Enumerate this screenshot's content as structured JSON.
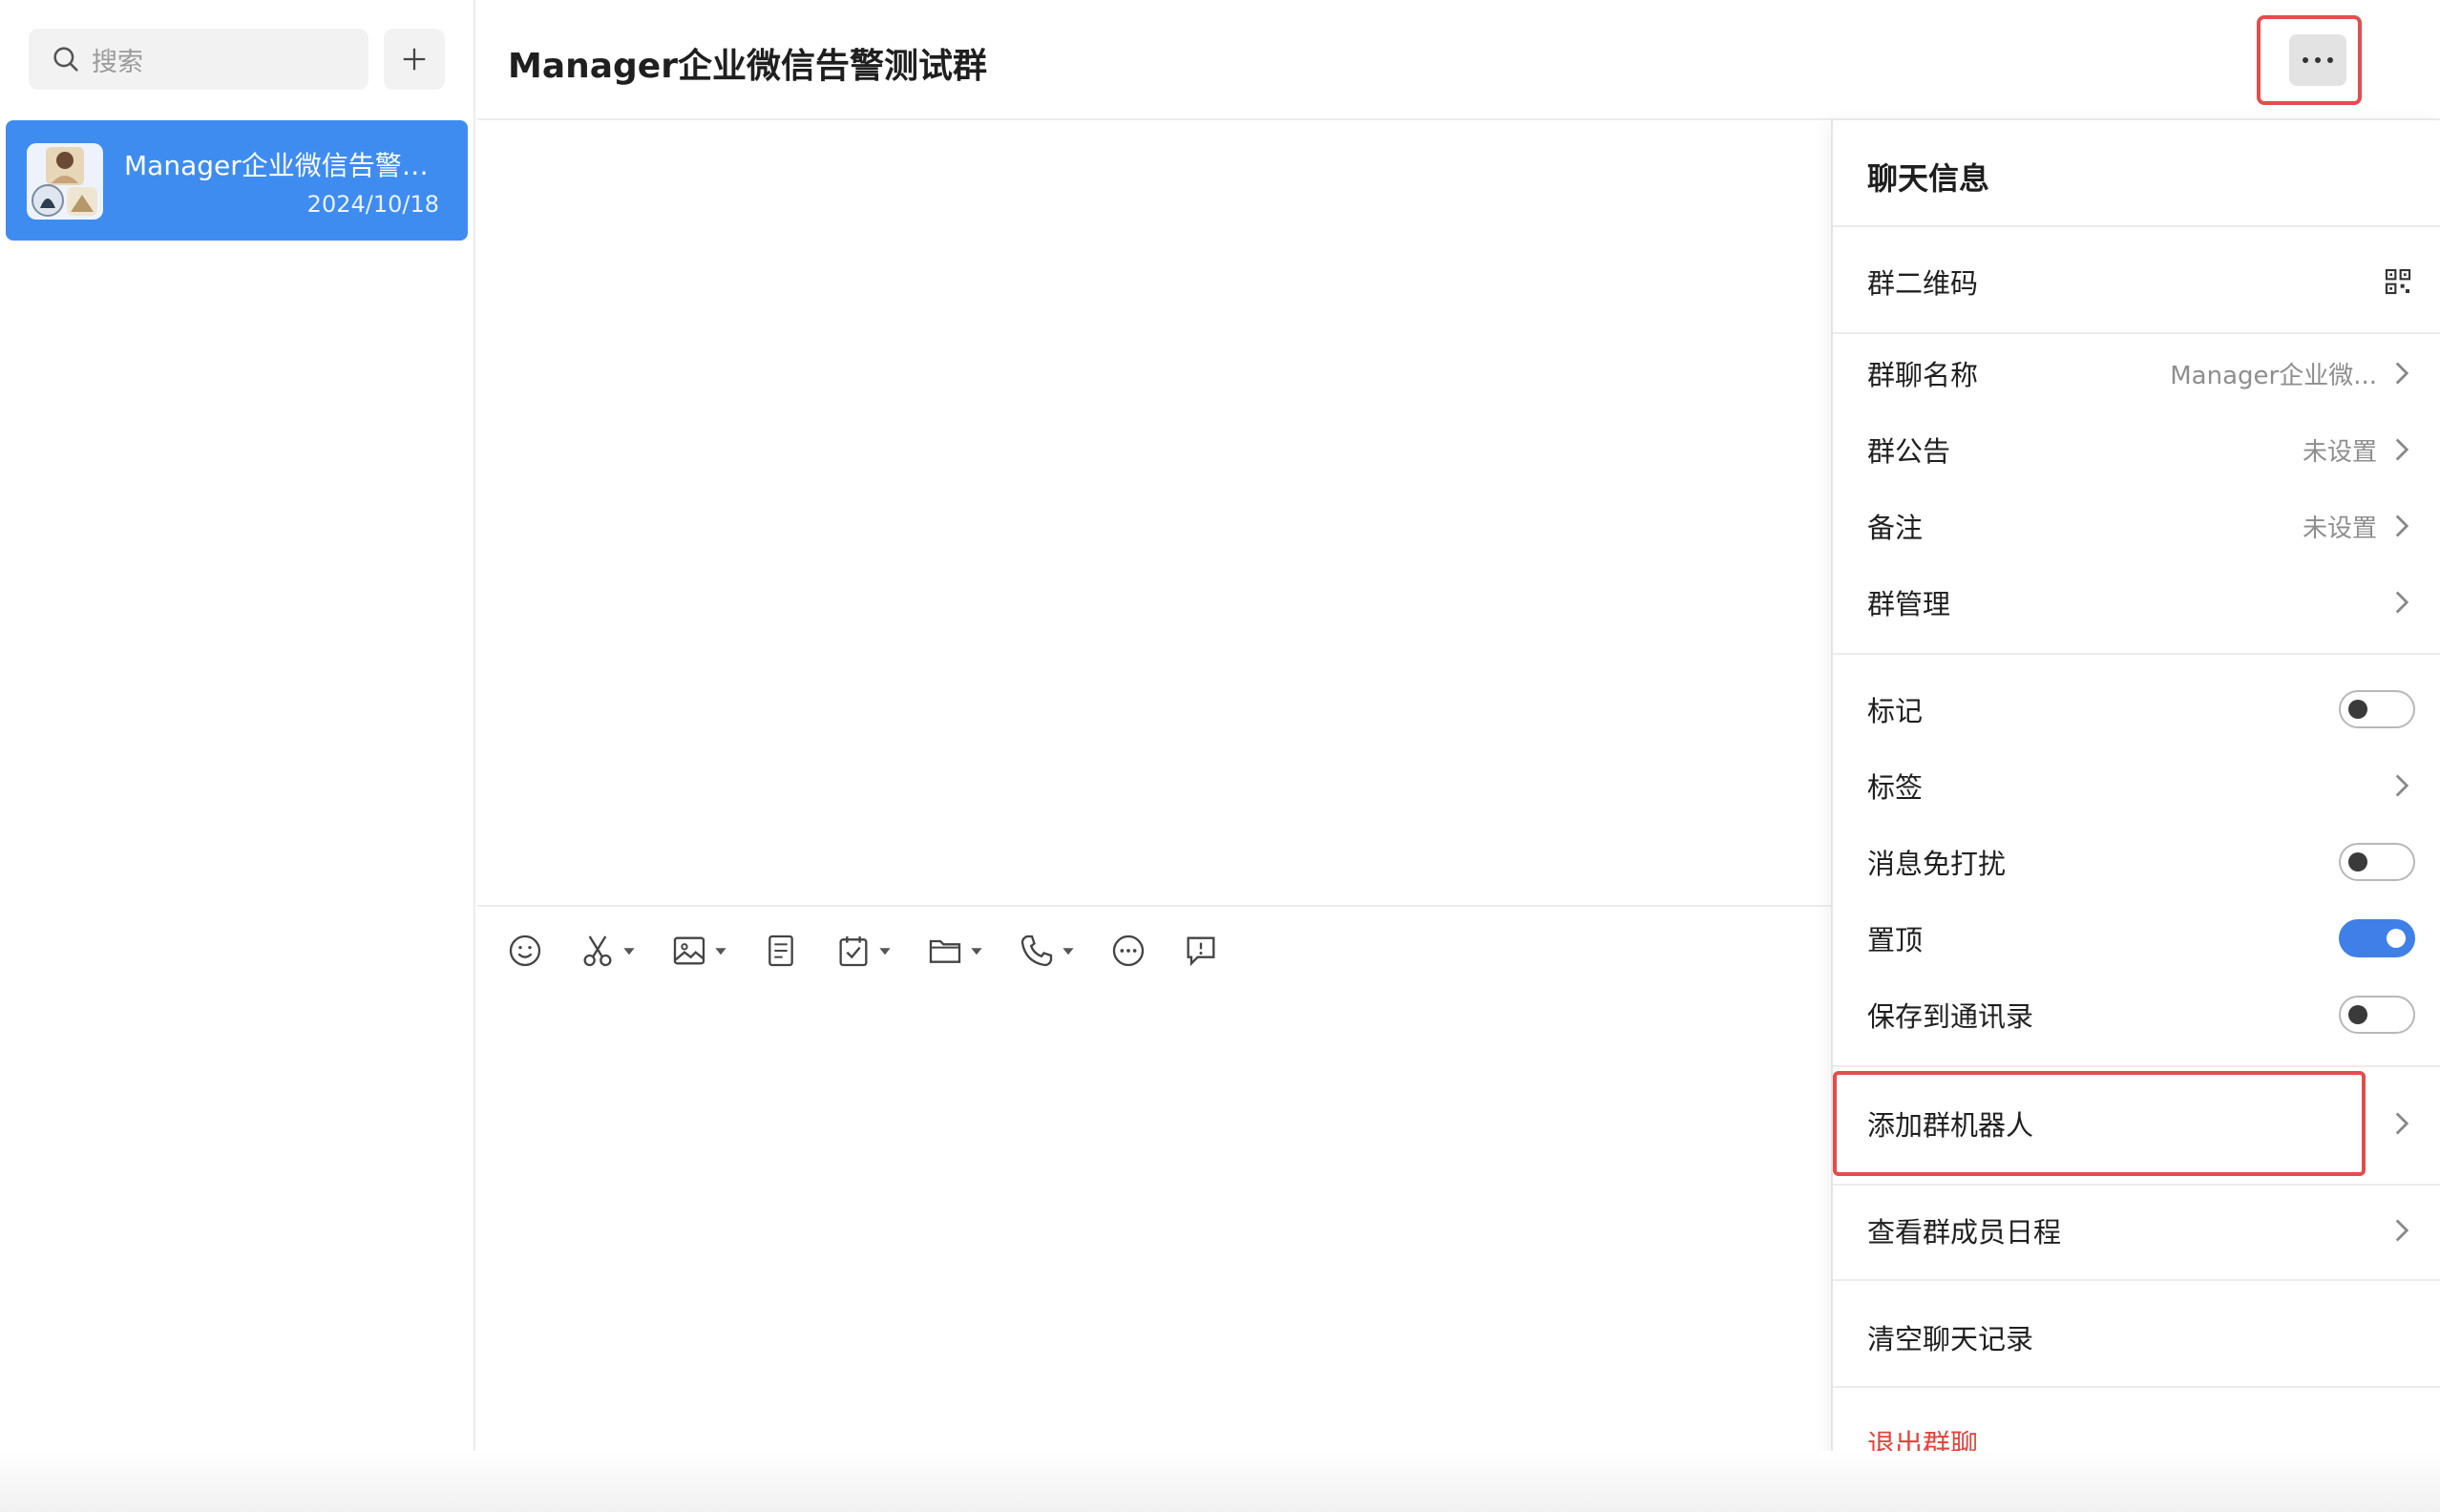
{
  "sidebar": {
    "search": {
      "placeholder": "搜索"
    },
    "conversations": [
      {
        "title": "Manager企业微信告警测试群",
        "date": "2024/10/18",
        "selected": true
      }
    ]
  },
  "chat": {
    "title": "Manager企业微信告警测试群",
    "toolbar": [
      "emoji-icon",
      "scissors-icon",
      "image-icon",
      "document-icon",
      "task-icon",
      "folder-icon",
      "phone-icon",
      "more-circle-icon",
      "chat-bubble-icon"
    ]
  },
  "panel": {
    "title": "聊天信息",
    "qr_label": "群二维码",
    "group_name_label": "群聊名称",
    "group_name_value": "Manager企业微...",
    "announcement_label": "群公告",
    "announcement_value": "未设置",
    "remark_label": "备注",
    "remark_value": "未设置",
    "manage_label": "群管理",
    "mark_label": "标记",
    "mark_on": false,
    "tags_label": "标签",
    "mute_label": "消息免打扰",
    "mute_on": false,
    "pin_label": "置顶",
    "pin_on": true,
    "save_contacts_label": "保存到通讯录",
    "save_contacts_on": false,
    "add_robot_label": "添加群机器人",
    "schedule_label": "查看群成员日程",
    "clear_history_label": "清空聊天记录",
    "leave_label": "退出群聊"
  },
  "colors": {
    "accent": "#3f8cf0",
    "toggle_on": "#3f7fe8",
    "danger": "#e1463f",
    "highlight": "#e34d4d"
  }
}
